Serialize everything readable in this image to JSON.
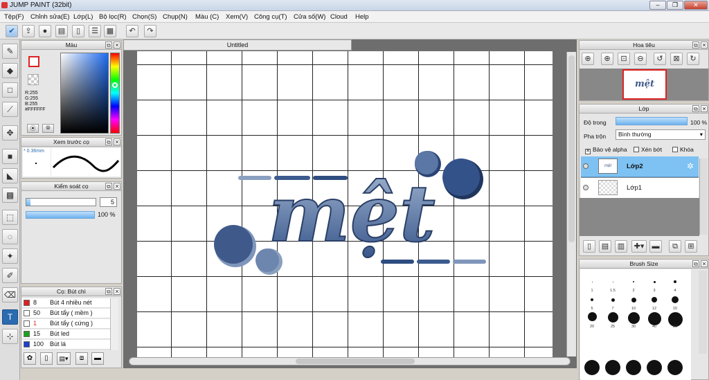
{
  "app": {
    "title": "JUMP PAINT (32bit)"
  },
  "window_buttons": [
    "–",
    "❐",
    "✕"
  ],
  "menu": [
    "Tệp(F)",
    "Chỉnh sửa(E)",
    "Lớp(L)",
    "Bộ lọc(R)",
    "Chọn(S)",
    "Chụp(N)",
    "Màu (C)",
    "Xem(V)",
    "Công cụ(T)",
    "Cửa số(W)",
    "Cloud",
    "Help"
  ],
  "document": {
    "tab": "Untitled",
    "art_text": "mệt"
  },
  "color_panel": {
    "title": "Màu",
    "r": "R:255",
    "g": "G:255",
    "b": "B:255",
    "hex": "#FFFFFF"
  },
  "brush_preview": {
    "title": "Xem trước cọ",
    "size": "* 0.36mm"
  },
  "brush_control": {
    "title": "Kiểm soát cọ",
    "size_value": "5",
    "opacity_value": "100 %"
  },
  "brush_list": {
    "title": "Cọ: Bút chì",
    "items": [
      {
        "color": "#e02020",
        "size": "8",
        "name": "Bút 4 nhiều nét"
      },
      {
        "color": "#ffffff",
        "size": "50",
        "name": "Bút tẩy ( mềm )"
      },
      {
        "color": "#ffffff",
        "size": "1",
        "name": "Bút tẩy ( cứng )"
      },
      {
        "color": "#19a319",
        "size": "15",
        "name": "Bút led"
      },
      {
        "color": "#2040d0",
        "size": "100",
        "name": "Bút lá"
      }
    ]
  },
  "navigator": {
    "title": "Hoa tiêu"
  },
  "layer_panel": {
    "title": "Lớp",
    "opacity_label": "Độ trong",
    "opacity_value": "100 %",
    "blend_label": "Pha trộn",
    "blend_value": "Bình thường",
    "protect_alpha": "Bảo vệ alpha",
    "clipping": "Xén bớt",
    "lock": "Khóa",
    "layers": [
      "Lớp2",
      "Lớp1"
    ]
  },
  "brush_size": {
    "title": "Brush Size",
    "row1": [
      "1",
      "1.5",
      "2",
      "3",
      "4"
    ],
    "row2": [
      "5",
      "7",
      "10",
      "12",
      "15"
    ],
    "row3": [
      "20",
      "25",
      "30",
      "40",
      "50"
    ]
  }
}
